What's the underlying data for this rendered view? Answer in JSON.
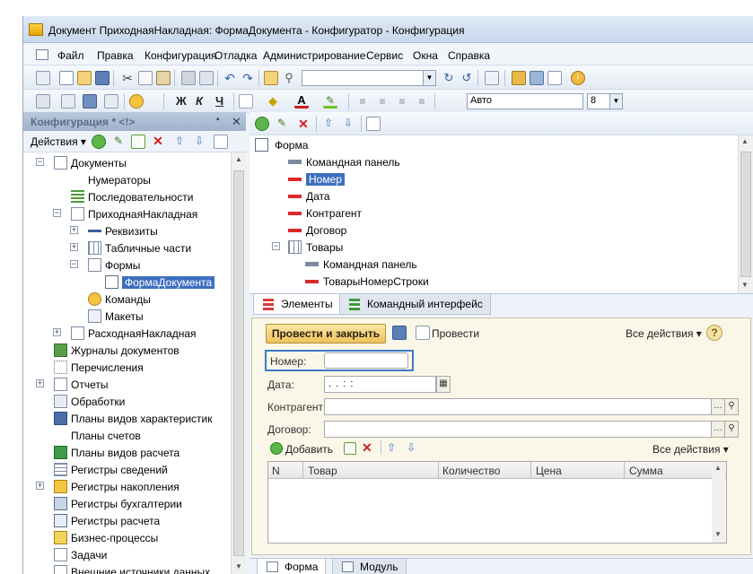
{
  "window": {
    "title": "Документ ПриходнаяНакладная: ФормаДокумента - Конфигуратор - Конфигурация"
  },
  "menu": [
    "Файл",
    "Правка",
    "Конфигурация",
    "Отладка",
    "Администрирование",
    "Сервис",
    "Окна",
    "Справка"
  ],
  "toolbar": {
    "font_name": "Авто",
    "font_size": "8",
    "bold": "Ж",
    "italic": "К",
    "underline": "Ч"
  },
  "config_panel": {
    "title": "Конфигурация * <!>",
    "actions_label": "Действия",
    "tree": [
      {
        "label": "Документы",
        "icon": "documents-icon",
        "expander": "−"
      },
      {
        "label": "Нумераторы",
        "icon": "numerators-icon"
      },
      {
        "label": "Последовательности",
        "icon": "sequences-icon"
      },
      {
        "label": "ПриходнаяНакладная",
        "icon": "document-icon",
        "expander": "−"
      },
      {
        "label": "Реквизиты",
        "icon": "attribute-icon",
        "expander": "+"
      },
      {
        "label": "Табличные части",
        "icon": "table-icon",
        "expander": "+"
      },
      {
        "label": "Формы",
        "icon": "forms-icon",
        "expander": "−"
      },
      {
        "label": "ФормаДокумента",
        "icon": "form-icon",
        "selected": true
      },
      {
        "label": "Команды",
        "icon": "commands-icon"
      },
      {
        "label": "Макеты",
        "icon": "templates-icon"
      },
      {
        "label": "РасходнаяНакладная",
        "icon": "document-icon",
        "expander": "+"
      },
      {
        "label": "Журналы документов",
        "icon": "journal-icon"
      },
      {
        "label": "Перечисления",
        "icon": "enum-icon"
      },
      {
        "label": "Отчеты",
        "icon": "reports-icon",
        "expander": "+"
      },
      {
        "label": "Обработки",
        "icon": "processing-icon"
      },
      {
        "label": "Планы видов характеристик",
        "icon": "chart-char-icon"
      },
      {
        "label": "Планы счетов",
        "icon": "chart-accounts-icon"
      },
      {
        "label": "Планы видов расчета",
        "icon": "chart-calc-icon"
      },
      {
        "label": "Регистры сведений",
        "icon": "info-register-icon"
      },
      {
        "label": "Регистры накопления",
        "icon": "accum-register-icon",
        "expander": "+"
      },
      {
        "label": "Регистры бухгалтерии",
        "icon": "acc-register-icon"
      },
      {
        "label": "Регистры расчета",
        "icon": "calc-register-icon"
      },
      {
        "label": "Бизнес-процессы",
        "icon": "business-process-icon"
      },
      {
        "label": "Задачи",
        "icon": "tasks-icon"
      },
      {
        "label": "Внешние источники данных",
        "icon": "external-sources-icon"
      }
    ]
  },
  "form_elements": {
    "tree": [
      {
        "label": "Форма",
        "icon": "form-icon"
      },
      {
        "label": "Командная панель",
        "icon": "command-bar-icon"
      },
      {
        "label": "Номер",
        "icon": "field-icon",
        "selected": true
      },
      {
        "label": "Дата",
        "icon": "field-icon"
      },
      {
        "label": "Контрагент",
        "icon": "field-icon"
      },
      {
        "label": "Договор",
        "icon": "field-icon"
      },
      {
        "label": "Товары",
        "icon": "table-icon",
        "expander": "−"
      },
      {
        "label": "Командная панель",
        "icon": "command-bar-icon"
      },
      {
        "label": "ТоварыНомерСтроки",
        "icon": "field-icon"
      }
    ],
    "tabs": [
      "Элементы",
      "Командный интерфейс"
    ]
  },
  "form_preview": {
    "post_close": "Провести и закрыть",
    "post": "Провести",
    "all_actions": "Все действия",
    "help": "?",
    "fields": [
      {
        "label": "Номер:",
        "value": ""
      },
      {
        "label": "Дата:",
        "value": " .  .      :  :  "
      },
      {
        "label": "Контрагент:",
        "value": ""
      },
      {
        "label": "Договор:",
        "value": ""
      }
    ],
    "add": "Добавить",
    "table_all_actions": "Все действия",
    "columns": [
      "N",
      "Товар",
      "Количество",
      "Цена",
      "Сумма"
    ]
  },
  "bottom_tabs": [
    "Форма",
    "Модуль"
  ]
}
